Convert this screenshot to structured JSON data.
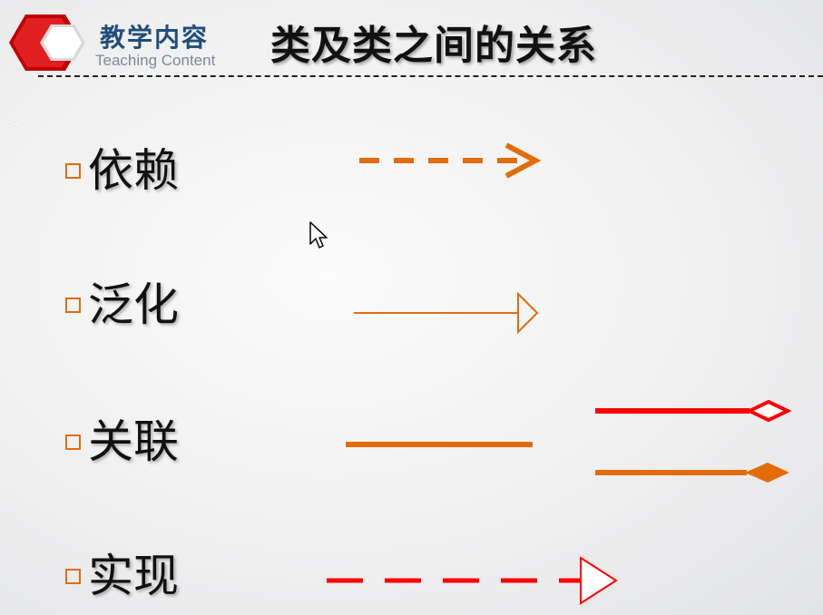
{
  "header": {
    "section_cn": "教学内容",
    "section_en": "Teaching Content",
    "title": "类及类之间的关系"
  },
  "slide": {
    "page_number": "24"
  },
  "items": [
    {
      "label": "依赖",
      "arrow": "dashed-open-arrow"
    },
    {
      "label": "泛化",
      "arrow": "hollow-triangle-arrow"
    },
    {
      "label": "关联",
      "arrow": "solid-line",
      "extra_arrows": [
        "hollow-diamond-line",
        "filled-diamond-line"
      ]
    },
    {
      "label": "实现",
      "arrow": "dashed-hollow-triangle-arrow"
    }
  ],
  "colors": {
    "orange": "#e36c09",
    "red": "#ff0000",
    "title_blue": "#1f4e79",
    "bullet": "#e36c09"
  }
}
